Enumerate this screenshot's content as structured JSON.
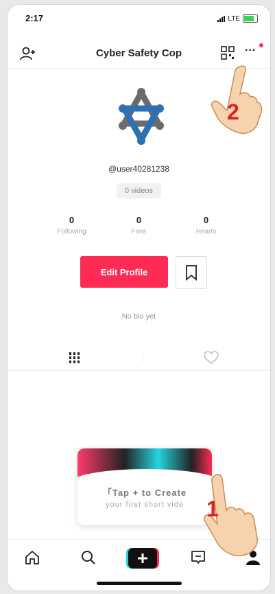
{
  "status_bar": {
    "time": "2:17",
    "network": "LTE"
  },
  "header": {
    "title": "Cyber Safety Cop"
  },
  "profile": {
    "username": "@user40281238",
    "videos_label": "0 videos",
    "stats": [
      {
        "value": "0",
        "label": "Following"
      },
      {
        "value": "0",
        "label": "Fans"
      },
      {
        "value": "0",
        "label": "Hearts"
      }
    ],
    "edit_button": "Edit Profile",
    "bio": "No bio yet"
  },
  "tooltip": {
    "line1": "「Tap + to Create",
    "line2": "your first short vide"
  },
  "annotations": {
    "step1": "1",
    "step2": "2"
  },
  "icons": {
    "add_user": "add-user-icon",
    "qr": "qr-code-icon",
    "more": "more-icon",
    "grid": "grid-icon",
    "heart": "heart-icon",
    "home": "home-icon",
    "search": "search-icon",
    "create": "create-plus-icon",
    "inbox": "inbox-icon",
    "me": "me-icon"
  },
  "colors": {
    "accent": "#fe2c55",
    "cyan": "#25d5e0",
    "logo_blue": "#2f6fb5",
    "logo_gray": "#6b6b6b"
  }
}
